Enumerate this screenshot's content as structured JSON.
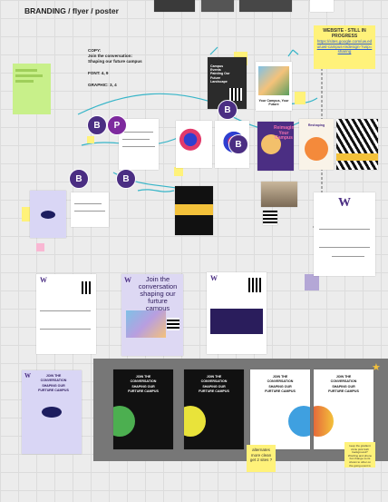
{
  "board": {
    "title": "BRANDING / flyer / poster",
    "copy_block": {
      "copy_label": "COPY:",
      "copy_line1": "Join the conversation:",
      "copy_line2": "Shaping our future campus",
      "font": "FONT: 4, 9",
      "graphic": "GRAPHIC: 3, 4"
    },
    "website_note": {
      "heading": "WEBSITE - STILL IN PROGRESS",
      "link": "https://sites.google.com/uw.edu/uwt-campus-redesign-?usp=sharing"
    },
    "alternates_note": "alternates more clean get 2 sites ?",
    "right_note": "keep the gradient circle pick both background? Wording and phone but change so its shown to other on the going event is",
    "avatars": [
      {
        "letter": "B"
      },
      {
        "letter": "P"
      },
      {
        "letter": "B"
      },
      {
        "letter": "B"
      },
      {
        "letter": "B"
      },
      {
        "letter": "B"
      }
    ],
    "posters_row1": {
      "p1_title": "Campus Events Painting Our Future Landscape",
      "p2_caption": "Your Campus, Your Future",
      "p3_title": "Reimagine Your Campus",
      "p4_title": "Reshaping"
    },
    "posters_row3": {
      "p_join": "Join the conversation shaping our furture campus"
    },
    "gray_posters": [
      {
        "line1": "JOIN THE",
        "line2": "CONVERSATION",
        "line3": "SHAPING OUR",
        "line4": "FURTURE CAMPUS"
      },
      {
        "line1": "JOIN THE",
        "line2": "CONVERSATION",
        "line3": "SHAPING OUR",
        "line4": "FURTURE CAMPUS"
      },
      {
        "line1": "JOIN THE",
        "line2": "CONVERSATION",
        "line3": "SHAPING OUR",
        "line4": "FURTURE CAMPUS"
      },
      {
        "line1": "JOIN THE",
        "line2": "CONVERSATION",
        "line3": "SHAPING OUR",
        "line4": "FURTURE CAMPUS"
      },
      {
        "line1": "JOIN THE",
        "line2": "CONVERSATION",
        "line3": "SHAPING OUR",
        "line4": "FURTURE CAMPUS"
      }
    ],
    "left_poster": {
      "line1": "JOIN THE",
      "line2": "CONVERSATION",
      "line3": "SHAPING OUR",
      "line4": "FURTURE CAMPUS"
    },
    "colors": {
      "uw_purple": "#4b2e83",
      "sticky_yellow": "#fff27a",
      "sticky_green": "#c8f08a",
      "sticky_pink": "#f9b7d3",
      "teal_connector": "#37b5c8"
    }
  }
}
